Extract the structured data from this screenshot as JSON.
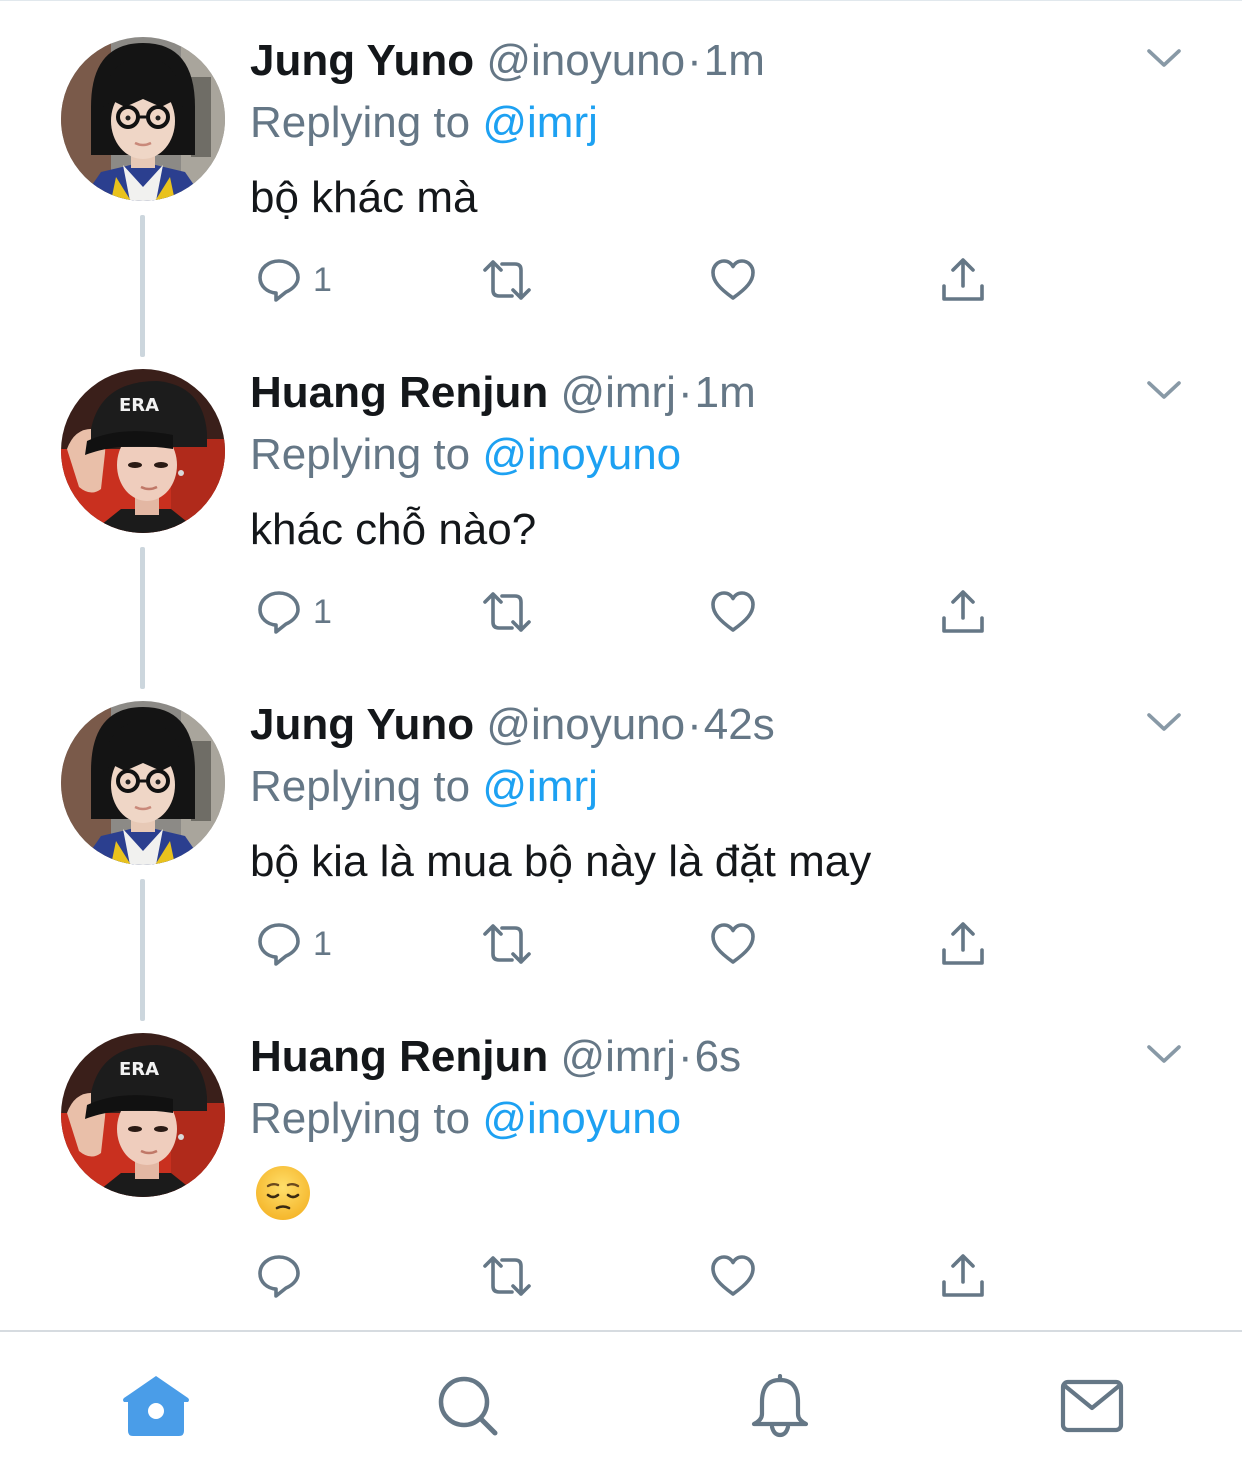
{
  "colors": {
    "accent": "#1da1f2",
    "secondary_text": "#657786",
    "primary_text": "#14171a",
    "thread_line": "#ccd6dd",
    "icon": "#657786",
    "tab_active": "#4a9de8"
  },
  "tweets": [
    {
      "display_name": "Jung Yuno",
      "handle": "@inoyuno",
      "dot": "·",
      "time": "1m",
      "replying_prefix": "Replying to ",
      "replying_handle": "@imrj",
      "text": "bộ khác mà",
      "reply_count": "1",
      "avatar": "jung-yuno-avatar",
      "has_thread_line": true
    },
    {
      "display_name": "Huang Renjun",
      "handle": "@imrj",
      "dot": "·",
      "time": "1m",
      "replying_prefix": "Replying to ",
      "replying_handle": "@inoyuno",
      "text": "khác chỗ nào?",
      "reply_count": "1",
      "avatar": "huang-renjun-avatar",
      "has_thread_line": true
    },
    {
      "display_name": "Jung Yuno",
      "handle": "@inoyuno",
      "dot": "·",
      "time": "42s",
      "replying_prefix": "Replying to ",
      "replying_handle": "@imrj",
      "text": "bộ kia là mua bộ này là đặt may",
      "reply_count": "1",
      "avatar": "jung-yuno-avatar",
      "has_thread_line": true
    },
    {
      "display_name": "Huang Renjun",
      "handle": "@imrj",
      "dot": "·",
      "time": "6s",
      "replying_prefix": "Replying to ",
      "replying_handle": "@inoyuno",
      "text": "",
      "emoji": "pensive-face-emoji",
      "reply_count": "",
      "avatar": "huang-renjun-avatar",
      "has_thread_line": false
    }
  ],
  "tabbar": {
    "items": [
      {
        "name": "home",
        "icon": "home-icon",
        "active": true
      },
      {
        "name": "search",
        "icon": "search-icon",
        "active": false
      },
      {
        "name": "notifications",
        "icon": "bell-icon",
        "active": false
      },
      {
        "name": "messages",
        "icon": "mail-icon",
        "active": false
      }
    ]
  }
}
